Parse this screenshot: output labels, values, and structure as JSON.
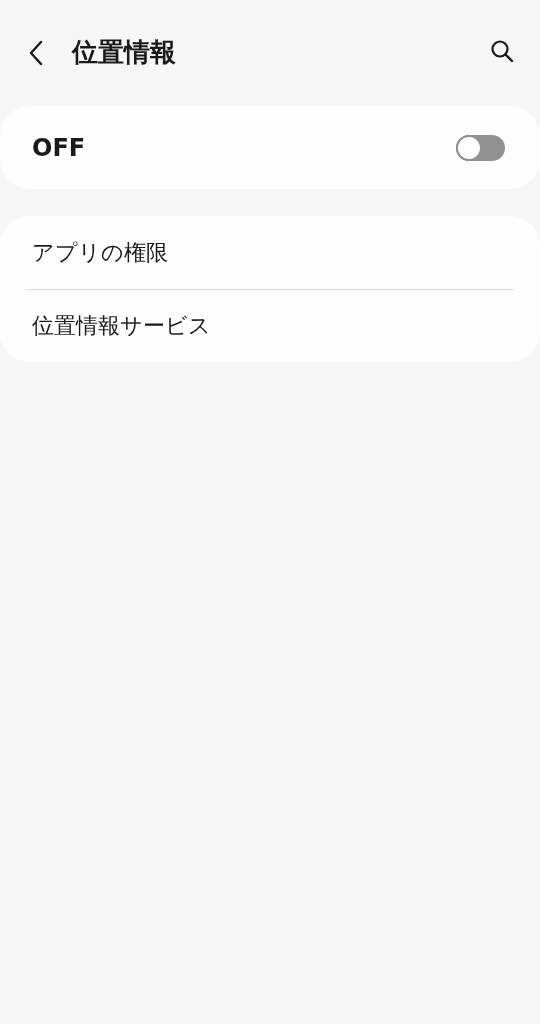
{
  "header": {
    "title": "位置情報"
  },
  "master_switch": {
    "label": "OFF",
    "on": false
  },
  "menu_items": [
    {
      "label": "アプリの権限"
    },
    {
      "label": "位置情報サービス"
    }
  ]
}
